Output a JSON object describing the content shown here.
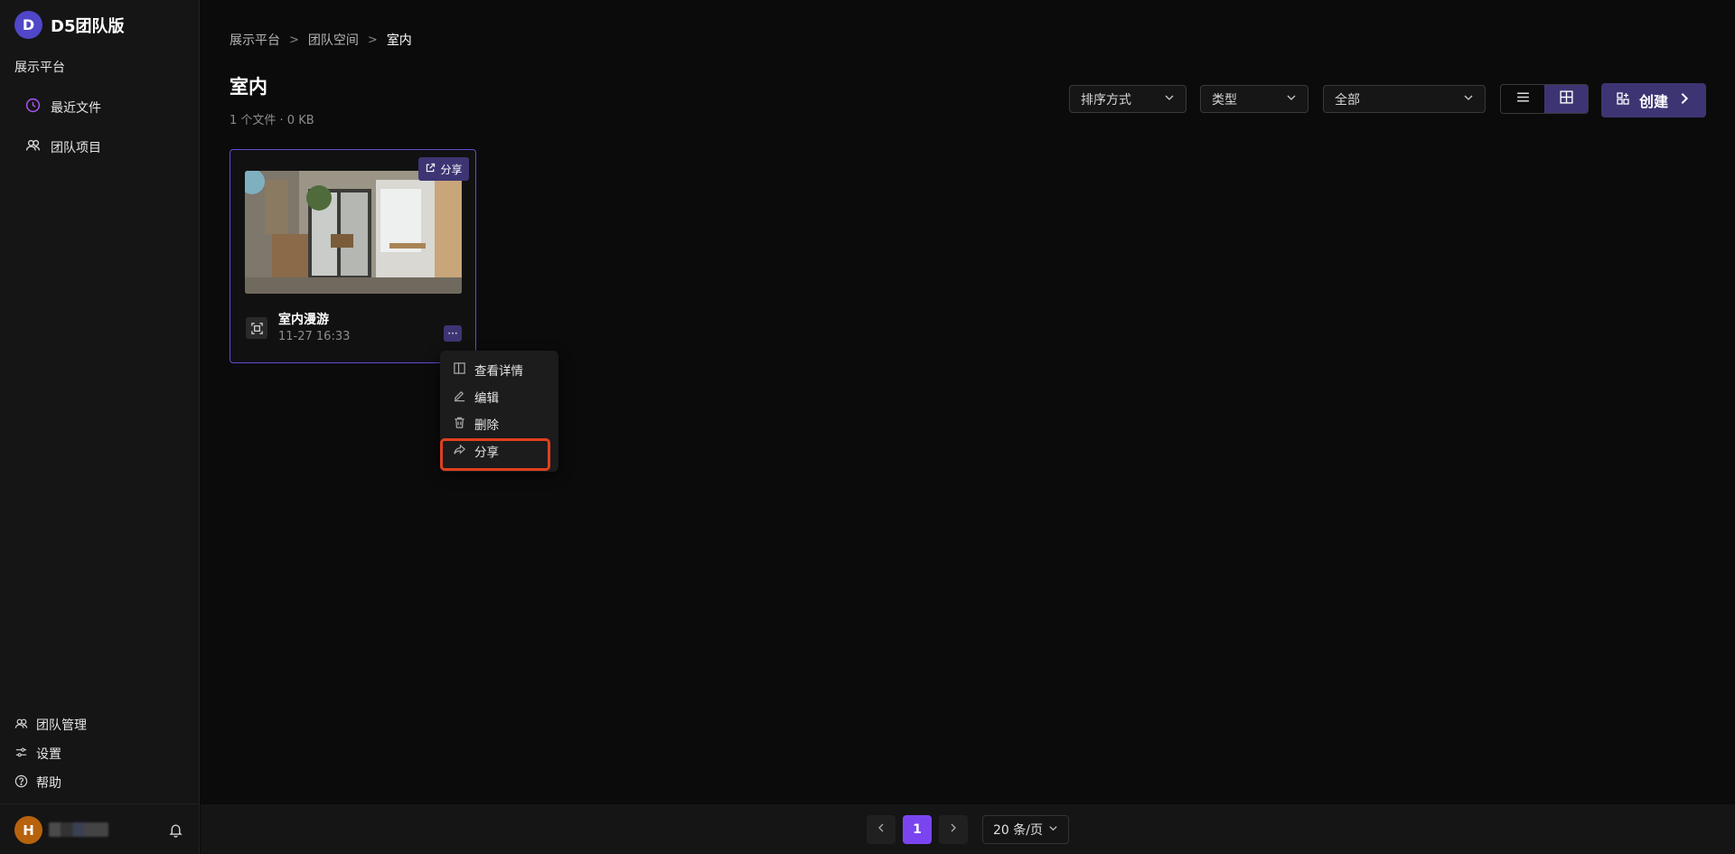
{
  "brand": {
    "logo_letter": "D",
    "name": "D5团队版"
  },
  "sidebar": {
    "section_title": "展示平台",
    "items": [
      {
        "label": "最近文件",
        "icon": "clock-icon",
        "color": "#a855f7"
      },
      {
        "label": "团队项目",
        "icon": "team-icon"
      }
    ],
    "bottom_items": [
      {
        "label": "团队管理",
        "icon": "team-icon"
      },
      {
        "label": "设置",
        "icon": "sliders-icon"
      },
      {
        "label": "帮助",
        "icon": "help-icon"
      }
    ],
    "user": {
      "avatar_letter": "H",
      "avatar_color": "#b7620c"
    }
  },
  "breadcrumb": [
    "展示平台",
    "团队空间",
    "室内"
  ],
  "page": {
    "title": "室内",
    "meta": "1 个文件 · 0 KB"
  },
  "toolbar": {
    "sort_label": "排序方式",
    "type_label": "类型",
    "filter_label": "全部",
    "create_label": "创建",
    "active_view": "grid"
  },
  "card": {
    "share_label": "分享",
    "name": "室内漫游",
    "date": "11-27 16:33",
    "more_label": "···"
  },
  "context_menu": {
    "items": [
      "查看详情",
      "编辑",
      "删除",
      "分享"
    ],
    "highlighted": "分享"
  },
  "pagination": {
    "current_page": "1",
    "page_size": "20 条/页"
  },
  "colors": {
    "accent": "#3d3573",
    "primary": "#7a45f0",
    "card_border": "#5c4fd6",
    "highlight": "#e0401f"
  }
}
